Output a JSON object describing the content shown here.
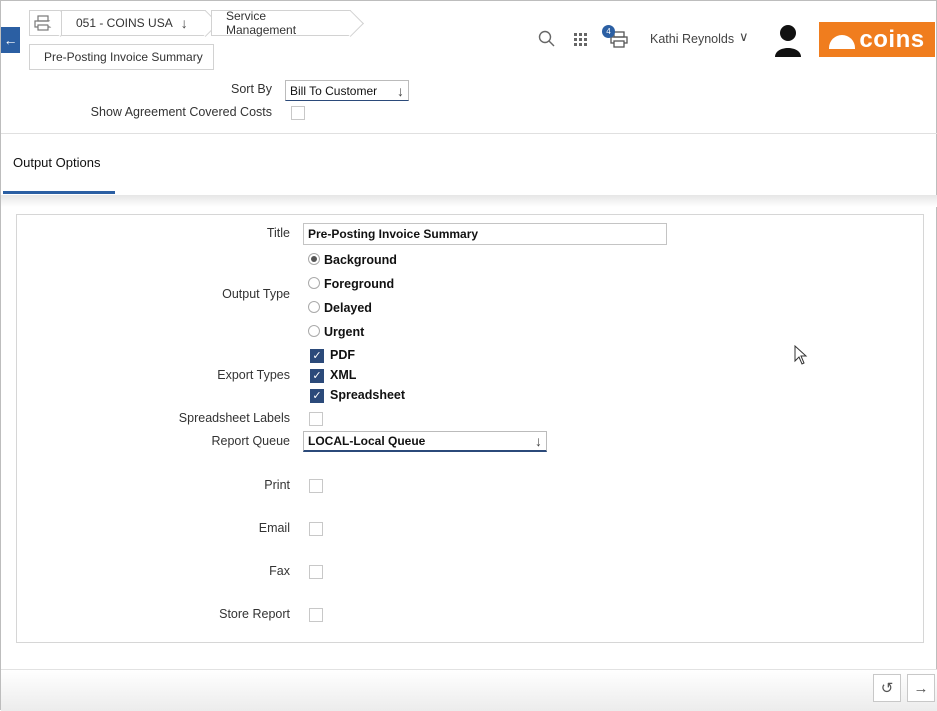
{
  "header": {
    "back_icon": "arrow-left-icon",
    "print_icon": "printer-icon",
    "company": "051 - COINS USA",
    "module": "Service Management",
    "page": "Pre-Posting Invoice Summary",
    "search_icon": "search-icon",
    "apps_icon": "grid-icon",
    "print_queue_count": "4",
    "user_name": "Kathi Reynolds",
    "logo_text": "coins",
    "accent_color": "#2b5fa3",
    "brand_color": "#f07d1e"
  },
  "filters": {
    "sort_by_label": "Sort By",
    "sort_by_value": "Bill To Customer",
    "show_agreement_label": "Show Agreement Covered Costs"
  },
  "tabs": {
    "output_options": "Output Options"
  },
  "output": {
    "title_label": "Title",
    "title_value": "Pre-Posting Invoice Summary",
    "output_type_label": "Output Type",
    "output_types": [
      "Background",
      "Foreground",
      "Delayed",
      "Urgent"
    ],
    "selected_output_type": "Background",
    "export_types_label": "Export Types",
    "export_types": [
      "PDF",
      "XML",
      "Spreadsheet"
    ],
    "spreadsheet_labels_label": "Spreadsheet Labels",
    "report_queue_label": "Report Queue",
    "report_queue_value": "LOCAL-Local Queue",
    "print_label": "Print",
    "email_label": "Email",
    "fax_label": "Fax",
    "store_report_label": "Store Report"
  }
}
